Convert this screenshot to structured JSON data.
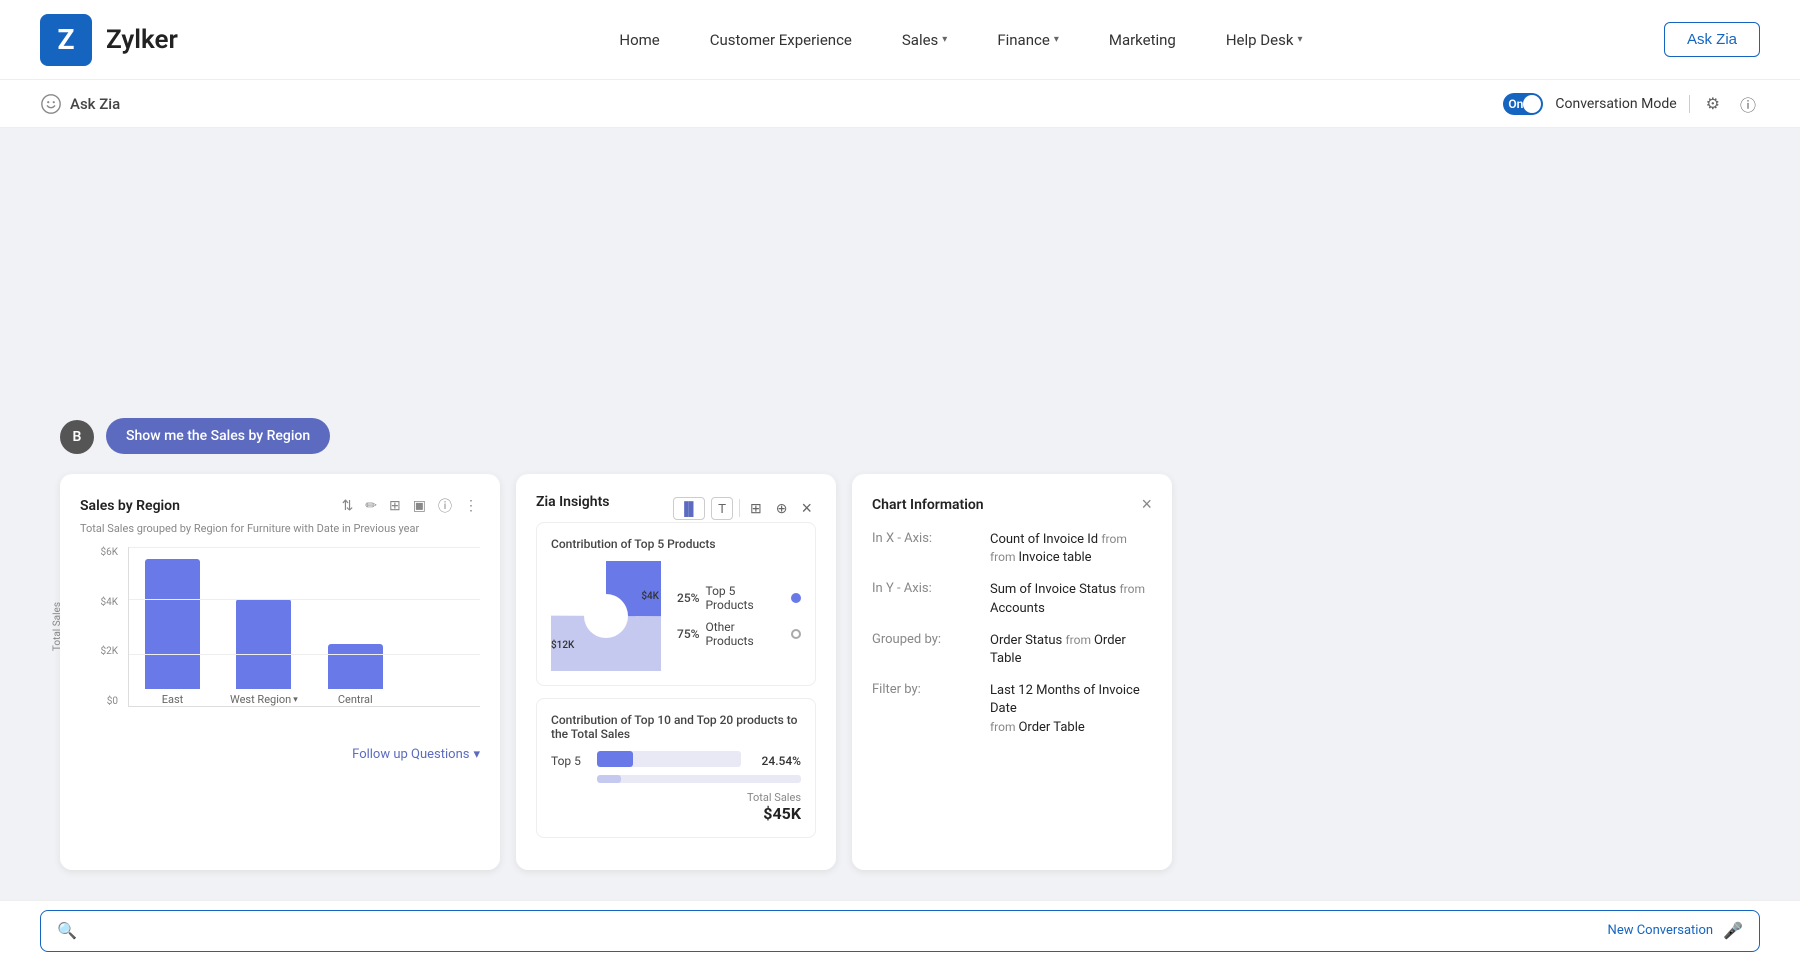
{
  "brand": {
    "letter": "Z",
    "name": "Zylker"
  },
  "nav": {
    "items": [
      {
        "label": "Home",
        "has_arrow": false
      },
      {
        "label": "Customer Experience",
        "has_arrow": false
      },
      {
        "label": "Sales",
        "has_arrow": true
      },
      {
        "label": "Finance",
        "has_arrow": true
      },
      {
        "label": "Marketing",
        "has_arrow": false
      },
      {
        "label": "Help Desk",
        "has_arrow": true
      }
    ],
    "ask_zia_btn": "Ask Zia"
  },
  "subheader": {
    "title": "Ask Zia",
    "toggle_label": "On",
    "conversation_mode": "Conversation Mode"
  },
  "chat": {
    "user_avatar": "B",
    "user_message": "Show me the Sales by Region"
  },
  "sales_panel": {
    "title": "Sales by Region",
    "subtitle": "Total Sales grouped by Region for Furniture with Date in Previous year",
    "y_labels": [
      "$6K",
      "$4K",
      "$2K",
      "$0"
    ],
    "y_axis_title": "Total Sales",
    "bars": [
      {
        "region": "East",
        "height_pct": 85,
        "label": "East"
      },
      {
        "region": "West",
        "height_pct": 60,
        "label": "West\nRegion ▾"
      },
      {
        "region": "Central",
        "height_pct": 30,
        "label": "Central"
      }
    ],
    "follow_up_label": "Follow up Questions",
    "toolbar": {
      "sort": "⇅",
      "edit": "✏",
      "grid": "⊞",
      "image": "🖼",
      "info": "ⓘ",
      "more": "⋮"
    }
  },
  "zia_insights": {
    "title": "Zia Insights",
    "section1_title": "Contribution of Top 5 Products",
    "pie": {
      "label_inner": "$4K",
      "label_outer": "$12K",
      "pct_top5": "25%",
      "top5_label": "Top 5 Products",
      "pct_others": "75%",
      "others_label": "Other Products"
    },
    "section2_title": "Contribution of Top 10 and Top 20 products to the Total Sales",
    "top5": {
      "label": "Top 5",
      "pct": "24.54%",
      "fill_pct": 25,
      "total_sales_label": "Total Sales",
      "total_sales_value": "$45K"
    }
  },
  "chart_info": {
    "title": "Chart Information",
    "x_axis_label": "In X - Axis:",
    "x_axis_value": "Count of Invoice Id",
    "x_axis_from": "from",
    "x_axis_table": "Invoice table",
    "y_axis_label": "In Y - Axis:",
    "y_axis_value": "Sum of Invoice Status",
    "y_axis_from": "from",
    "y_axis_table": "Accounts",
    "grouped_label": "Grouped by:",
    "grouped_value": "Order Status",
    "grouped_from": "from",
    "grouped_table": "Order Table",
    "filter_label": "Filter by:",
    "filter_value": "Last 12 Months of Invoice Date",
    "filter_from": "from",
    "filter_table": "Order Table"
  },
  "bottom_bar": {
    "placeholder": "",
    "new_conversation": "New Conversation"
  }
}
